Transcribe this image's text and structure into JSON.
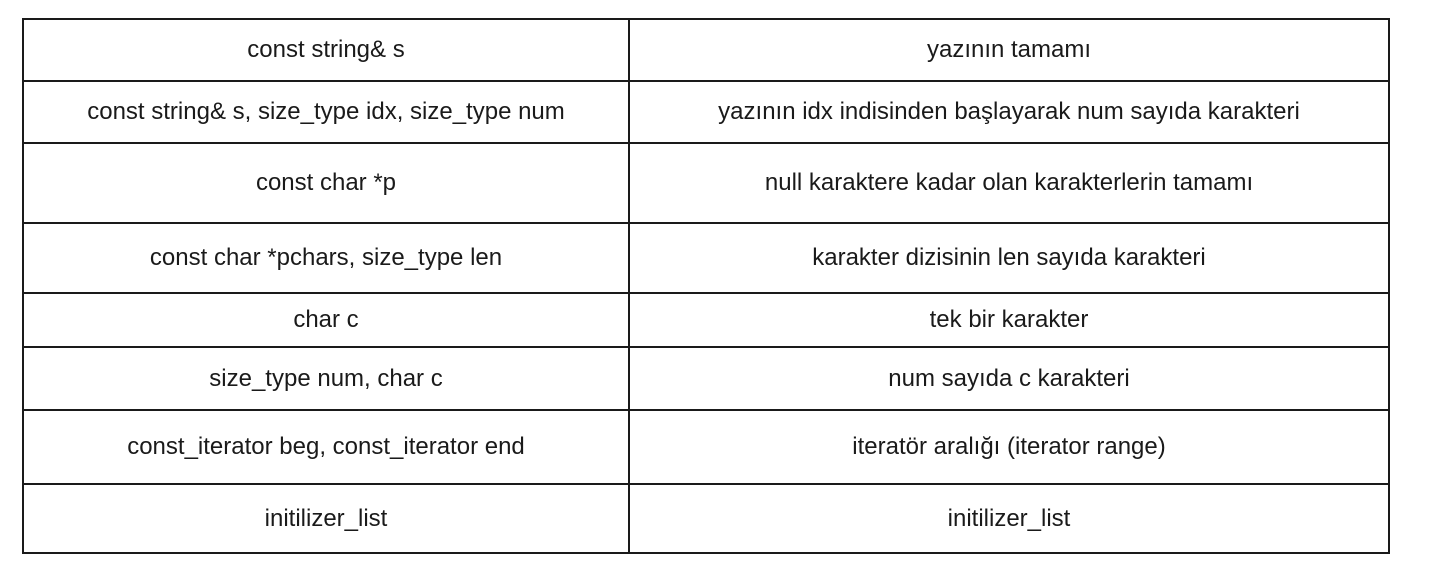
{
  "table": {
    "rows": [
      {
        "param": "const string& s",
        "desc": "yazının tamamı"
      },
      {
        "param": "const string& s, size_type idx, size_type num",
        "desc": "yazının idx indisinden başlayarak num sayıda karakteri"
      },
      {
        "param": "const char *p",
        "desc": "null karaktere kadar olan karakterlerin tamamı"
      },
      {
        "param": "const char *pchars, size_type len",
        "desc": "karakter dizisinin len sayıda karakteri"
      },
      {
        "param": "char c",
        "desc": "tek bir karakter"
      },
      {
        "param": "size_type num, char c",
        "desc": "num sayıda c karakteri"
      },
      {
        "param": "const_iterator beg, const_iterator end",
        "desc": "iteratör aralığı (iterator range)"
      },
      {
        "param": "initilizer_list",
        "desc": "initilizer_list"
      }
    ]
  }
}
